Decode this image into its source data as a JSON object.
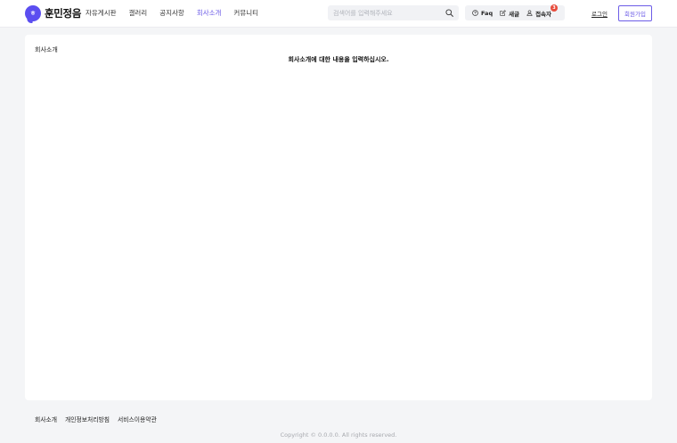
{
  "brand": {
    "name": "훈민정음",
    "mark_glyph": "ㅎ",
    "accent_color": "#6c5ce7"
  },
  "nav": {
    "items": [
      {
        "label": "자유게시판"
      },
      {
        "label": "갤러리"
      },
      {
        "label": "공지사항"
      },
      {
        "label": "회사소개",
        "active": true
      },
      {
        "label": "커뮤니티"
      }
    ]
  },
  "search": {
    "placeholder": "검색어를 입력해주세요",
    "icon": "search-icon"
  },
  "tools": {
    "faq_label": "Faq",
    "write_label": "새글",
    "visitors_label": "접속자",
    "visitors_count": "3"
  },
  "auth": {
    "login_label": "로그인",
    "signup_label": "회원가입"
  },
  "page": {
    "title": "회사소개",
    "content": "회사소개에 대한 내용을 입력하십시오."
  },
  "footer": {
    "links": [
      {
        "label": "회사소개"
      },
      {
        "label": "개인정보처리방침"
      },
      {
        "label": "서비스이용약관"
      }
    ],
    "copyright": "Copyright © 0.0.0.0. All rights reserved."
  }
}
